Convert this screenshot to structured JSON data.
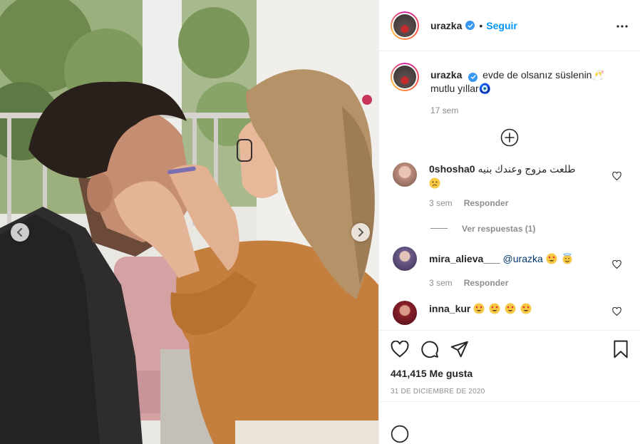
{
  "post": {
    "username": "urazka",
    "follow_label": "Seguir",
    "separator": "•",
    "caption": "evde de olsanız süslenin🥂 mutlu yıllar🧿",
    "caption_time": "17 sem"
  },
  "comments": [
    {
      "username": "0shosha0",
      "text": "طلعت مزوج وعندك بنيه",
      "time": "3 sem",
      "reply_label": "Responder",
      "avatar_color": "#b98a7a"
    },
    {
      "username": "mira_alieva___",
      "mention": "@urazka",
      "time": "3 sem",
      "reply_label": "Responder",
      "avatar_color": "#6b5a8a"
    },
    {
      "username": "inna_kur",
      "avatar_color": "#8a1f2a"
    }
  ],
  "view_replies_label": "Ver respuestas (1)",
  "likes": "441,415 Me gusta",
  "date": "31 DE DICIEMBRE DE 2020",
  "colors": {
    "accent": "#0095f6",
    "verified": "#3897f0",
    "muted": "#8e8e8e",
    "text": "#262626"
  },
  "icons": [
    "heart-icon",
    "comment-icon",
    "share-icon",
    "bookmark-icon",
    "more-icon",
    "plus-circle-icon",
    "chevron-left-icon",
    "chevron-right-icon"
  ]
}
